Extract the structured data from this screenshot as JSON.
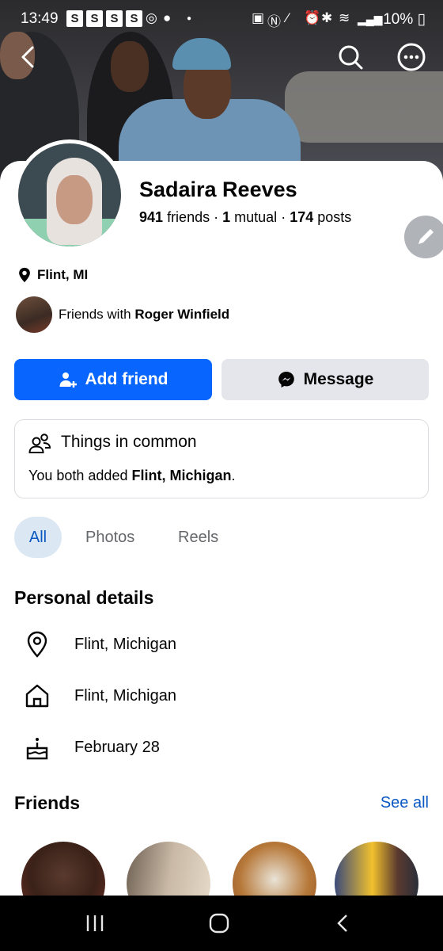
{
  "status_bar": {
    "time": "13:49",
    "s_icons": [
      "S",
      "S",
      "S",
      "S"
    ],
    "battery": "10%"
  },
  "header": {
    "back_icon": "chevron-left-icon",
    "search_icon": "search-icon",
    "more_icon": "more-horizontal-icon"
  },
  "profile": {
    "name": "Sadaira Reeves",
    "friends_count": "941",
    "friends_label": "friends",
    "mutual_count": "1",
    "mutual_label": "mutual",
    "posts_count": "174",
    "posts_label": "posts",
    "location": "Flint, MI",
    "friends_with_prefix": "Friends with",
    "friends_with_name": "Roger Winfield"
  },
  "actions": {
    "add_friend": "Add friend",
    "message": "Message"
  },
  "common": {
    "title": "Things in common",
    "body_prefix": "You both added",
    "body_place": "Flint, Michigan",
    "body_suffix": "."
  },
  "tabs": [
    {
      "label": "All",
      "active": true
    },
    {
      "label": "Photos",
      "active": false
    },
    {
      "label": "Reels",
      "active": false
    }
  ],
  "personal_details": {
    "heading": "Personal details",
    "items": [
      {
        "icon": "location-pin-icon",
        "text": "Flint, Michigan"
      },
      {
        "icon": "home-icon",
        "text": "Flint, Michigan"
      },
      {
        "icon": "birthday-cake-icon",
        "text": "February 28"
      }
    ]
  },
  "friends": {
    "heading": "Friends",
    "see_all": "See all"
  },
  "colors": {
    "primary": "#0866ff",
    "link": "#0a58c2",
    "secondary_button": "#e4e6eb",
    "chip_active_bg": "#dbe7f2"
  }
}
